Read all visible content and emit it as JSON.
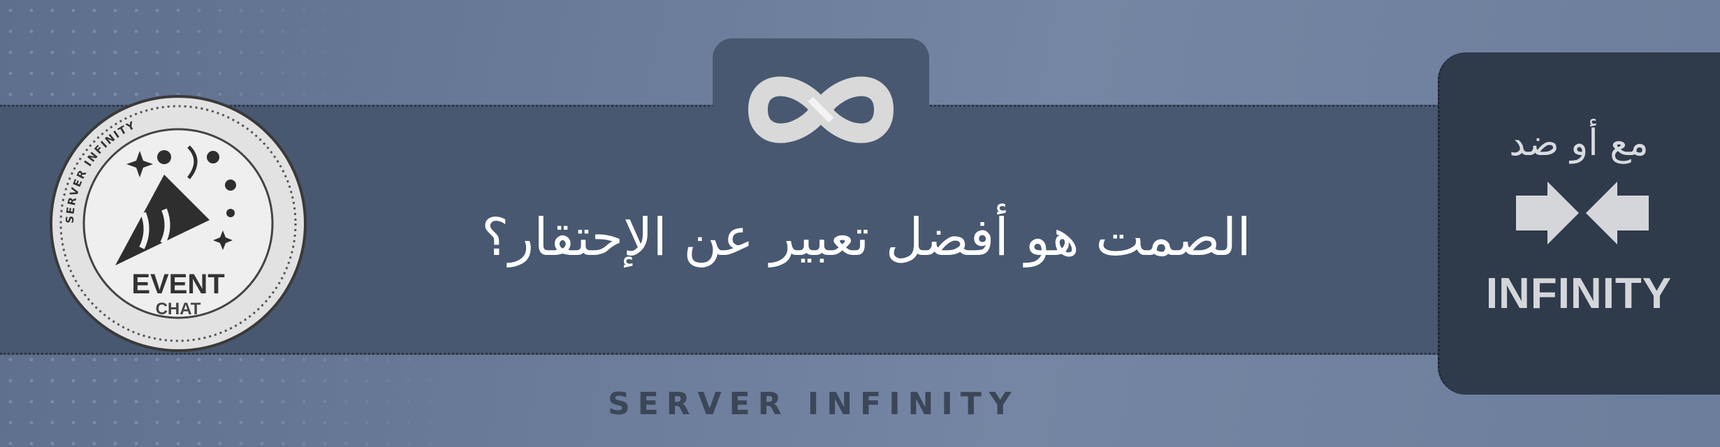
{
  "headline": "الصمت هو أفضل تعبير عن الإحتقار؟",
  "footer": "SERVER INFINITY",
  "badge": {
    "ring_text": "SERVER INFINITY",
    "title": "EVENT",
    "subtitle": "CHAT",
    "icon": "party-popper-icon"
  },
  "side_panel": {
    "tagline": "مع أو ضد",
    "brand": "INFINITY",
    "icon": "versus-arrows-icon"
  },
  "logo": {
    "icon": "infinity-icon"
  },
  "colors": {
    "background": "#6a7c9a",
    "band": "#485870",
    "side_panel": "#2f3a4b",
    "text_light": "#ffffff",
    "logo": "#d9d9d9"
  }
}
